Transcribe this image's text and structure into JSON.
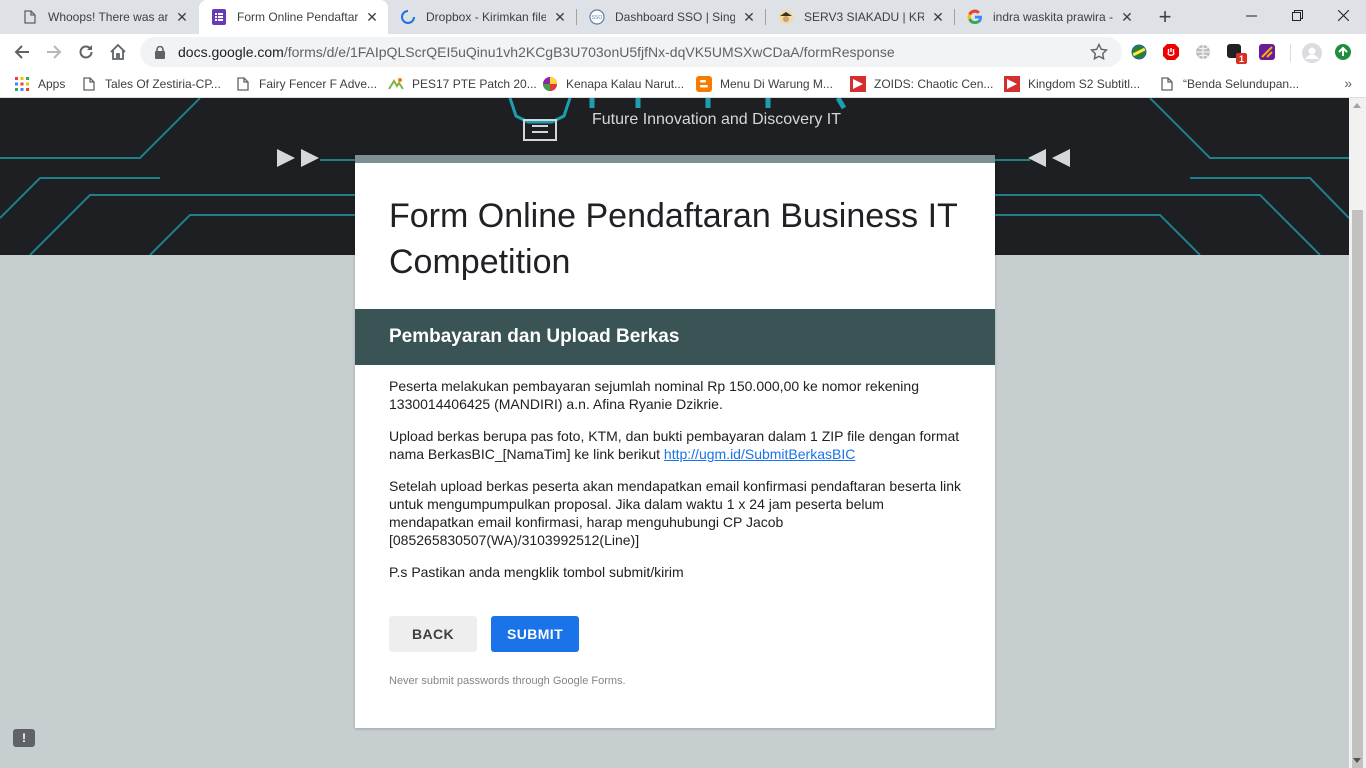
{
  "browser": {
    "tabs": [
      {
        "title": "Whoops! There was an",
        "icon": "document-icon"
      },
      {
        "title": "Form Online Pendaftaran",
        "icon": "google-forms-icon",
        "active": true
      },
      {
        "title": "Dropbox - Kirimkan file",
        "icon": "loading-spinner-icon"
      },
      {
        "title": "Dashboard SSO | Single",
        "icon": "sso-icon"
      },
      {
        "title": "SERV3 SIAKADU | KRS M",
        "icon": "siakadu-icon"
      },
      {
        "title": "indra waskita prawira -",
        "icon": "google-icon"
      }
    ],
    "url_host": "docs.google.com",
    "url_path": "/forms/d/e/1FAIpQLScrQEI5uQinu1vh2KCgB3U703onU5fjfNx-dqVK5UMSXwCDaA/formResponse",
    "bookmarks": [
      {
        "label": "Apps",
        "icon": "apps-grid-icon"
      },
      {
        "label": "Tales Of Zestiria-CP...",
        "icon": "document-icon"
      },
      {
        "label": "Fairy Fencer F Adve...",
        "icon": "document-icon"
      },
      {
        "label": "PES17 PTE Patch 20...",
        "icon": "pes-icon"
      },
      {
        "label": "Kenapa Kalau Narut...",
        "icon": "colorful-ball-icon"
      },
      {
        "label": "Menu Di Warung M...",
        "icon": "blogger-icon"
      },
      {
        "label": "ZOIDS: Chaotic Cen...",
        "icon": "red-play-icon"
      },
      {
        "label": "Kingdom S2 Subtitl...",
        "icon": "red-play-icon"
      },
      {
        "label": "“Benda Selundupan...",
        "icon": "document-icon"
      }
    ],
    "extension_badge": "1"
  },
  "banner": {
    "tagline": "Future Innovation and Discovery IT"
  },
  "form": {
    "title": "Form Online Pendaftaran Business IT Competition",
    "section_title": "Pembayaran dan Upload Berkas",
    "paragraphs": {
      "p1": "Peserta melakukan pembayaran sejumlah nominal Rp 150.000,00 ke nomor rekening 1330014406425 (MANDIRI) a.n. Afina Ryanie Dzikrie.",
      "p2_prefix": "Upload berkas berupa pas foto, KTM, dan bukti pembayaran dalam 1 ZIP file dengan format nama BerkasBIC_[NamaTim] ke link berikut ",
      "p2_link": "http://ugm.id/SubmitBerkasBIC",
      "p3": "Setelah upload berkas peserta akan mendapatkan email konfirmasi pendaftaran beserta link untuk mengumpumpulkan proposal. Jika dalam waktu 1 x 24 jam peserta belum mendapatkan email konfirmasi, harap menguhubungi CP Jacob [085265830507(WA)/3103992512(Line)]",
      "p4": "P.s Pastikan anda mengklik tombol submit/kirim"
    },
    "back_label": "BACK",
    "submit_label": "SUBMIT",
    "footer_note": "Never submit passwords through Google Forms."
  },
  "colors": {
    "section_header": "#3a5355",
    "card_topbar": "#7f9092",
    "submit_button": "#1a73e8",
    "page_background": "#c7ced0",
    "banner_background": "#1d1f22",
    "banner_lines": "#1f7f8c"
  }
}
